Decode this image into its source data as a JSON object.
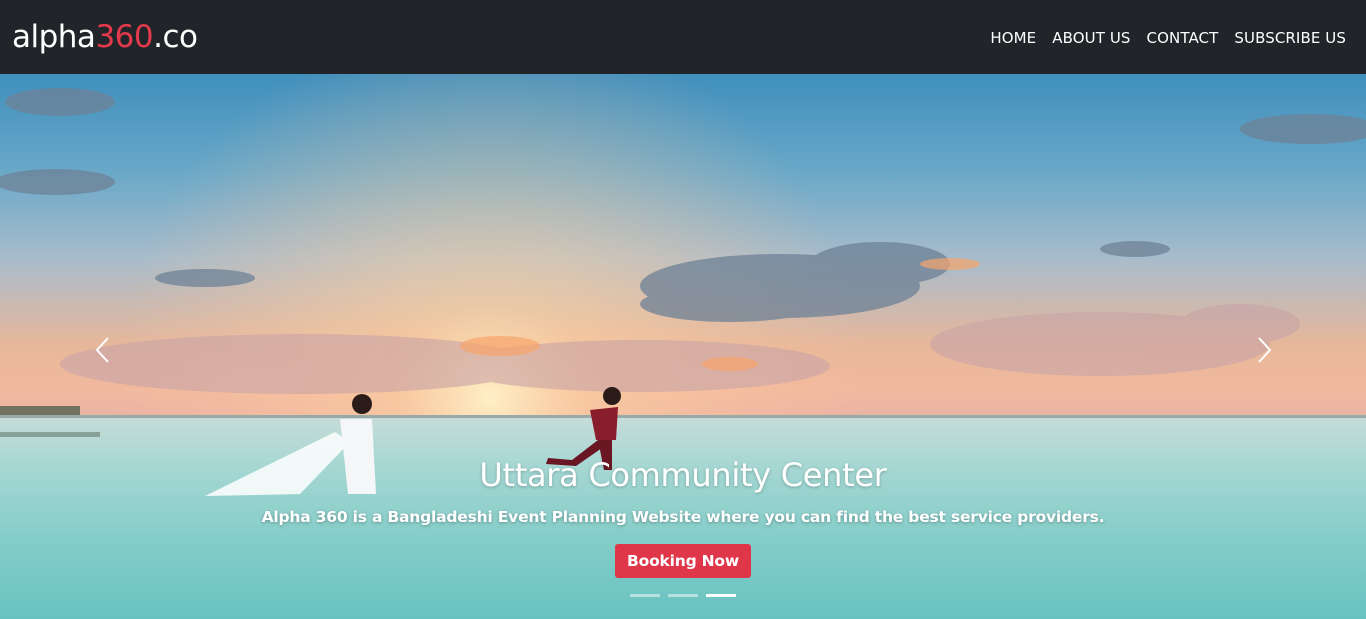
{
  "brand": {
    "prefix": "alpha",
    "accent": "360",
    "suffix": ".co",
    "accent_color": "#e23a4c"
  },
  "nav": {
    "items": [
      {
        "label": "HOME"
      },
      {
        "label": "ABOUT US"
      },
      {
        "label": "CONTACT"
      },
      {
        "label": "SUBSCRIBE US"
      }
    ]
  },
  "hero": {
    "title": "Uttara Community Center",
    "description": "Alpha 360 is a Bangladeshi Event Planning Website where you can find the best service providers.",
    "button_label": "Booking Now",
    "button_color": "#e0364a",
    "prev_icon": "chevron-left-icon",
    "next_icon": "chevron-right-icon",
    "slide_count": 3,
    "active_slide": 3
  }
}
